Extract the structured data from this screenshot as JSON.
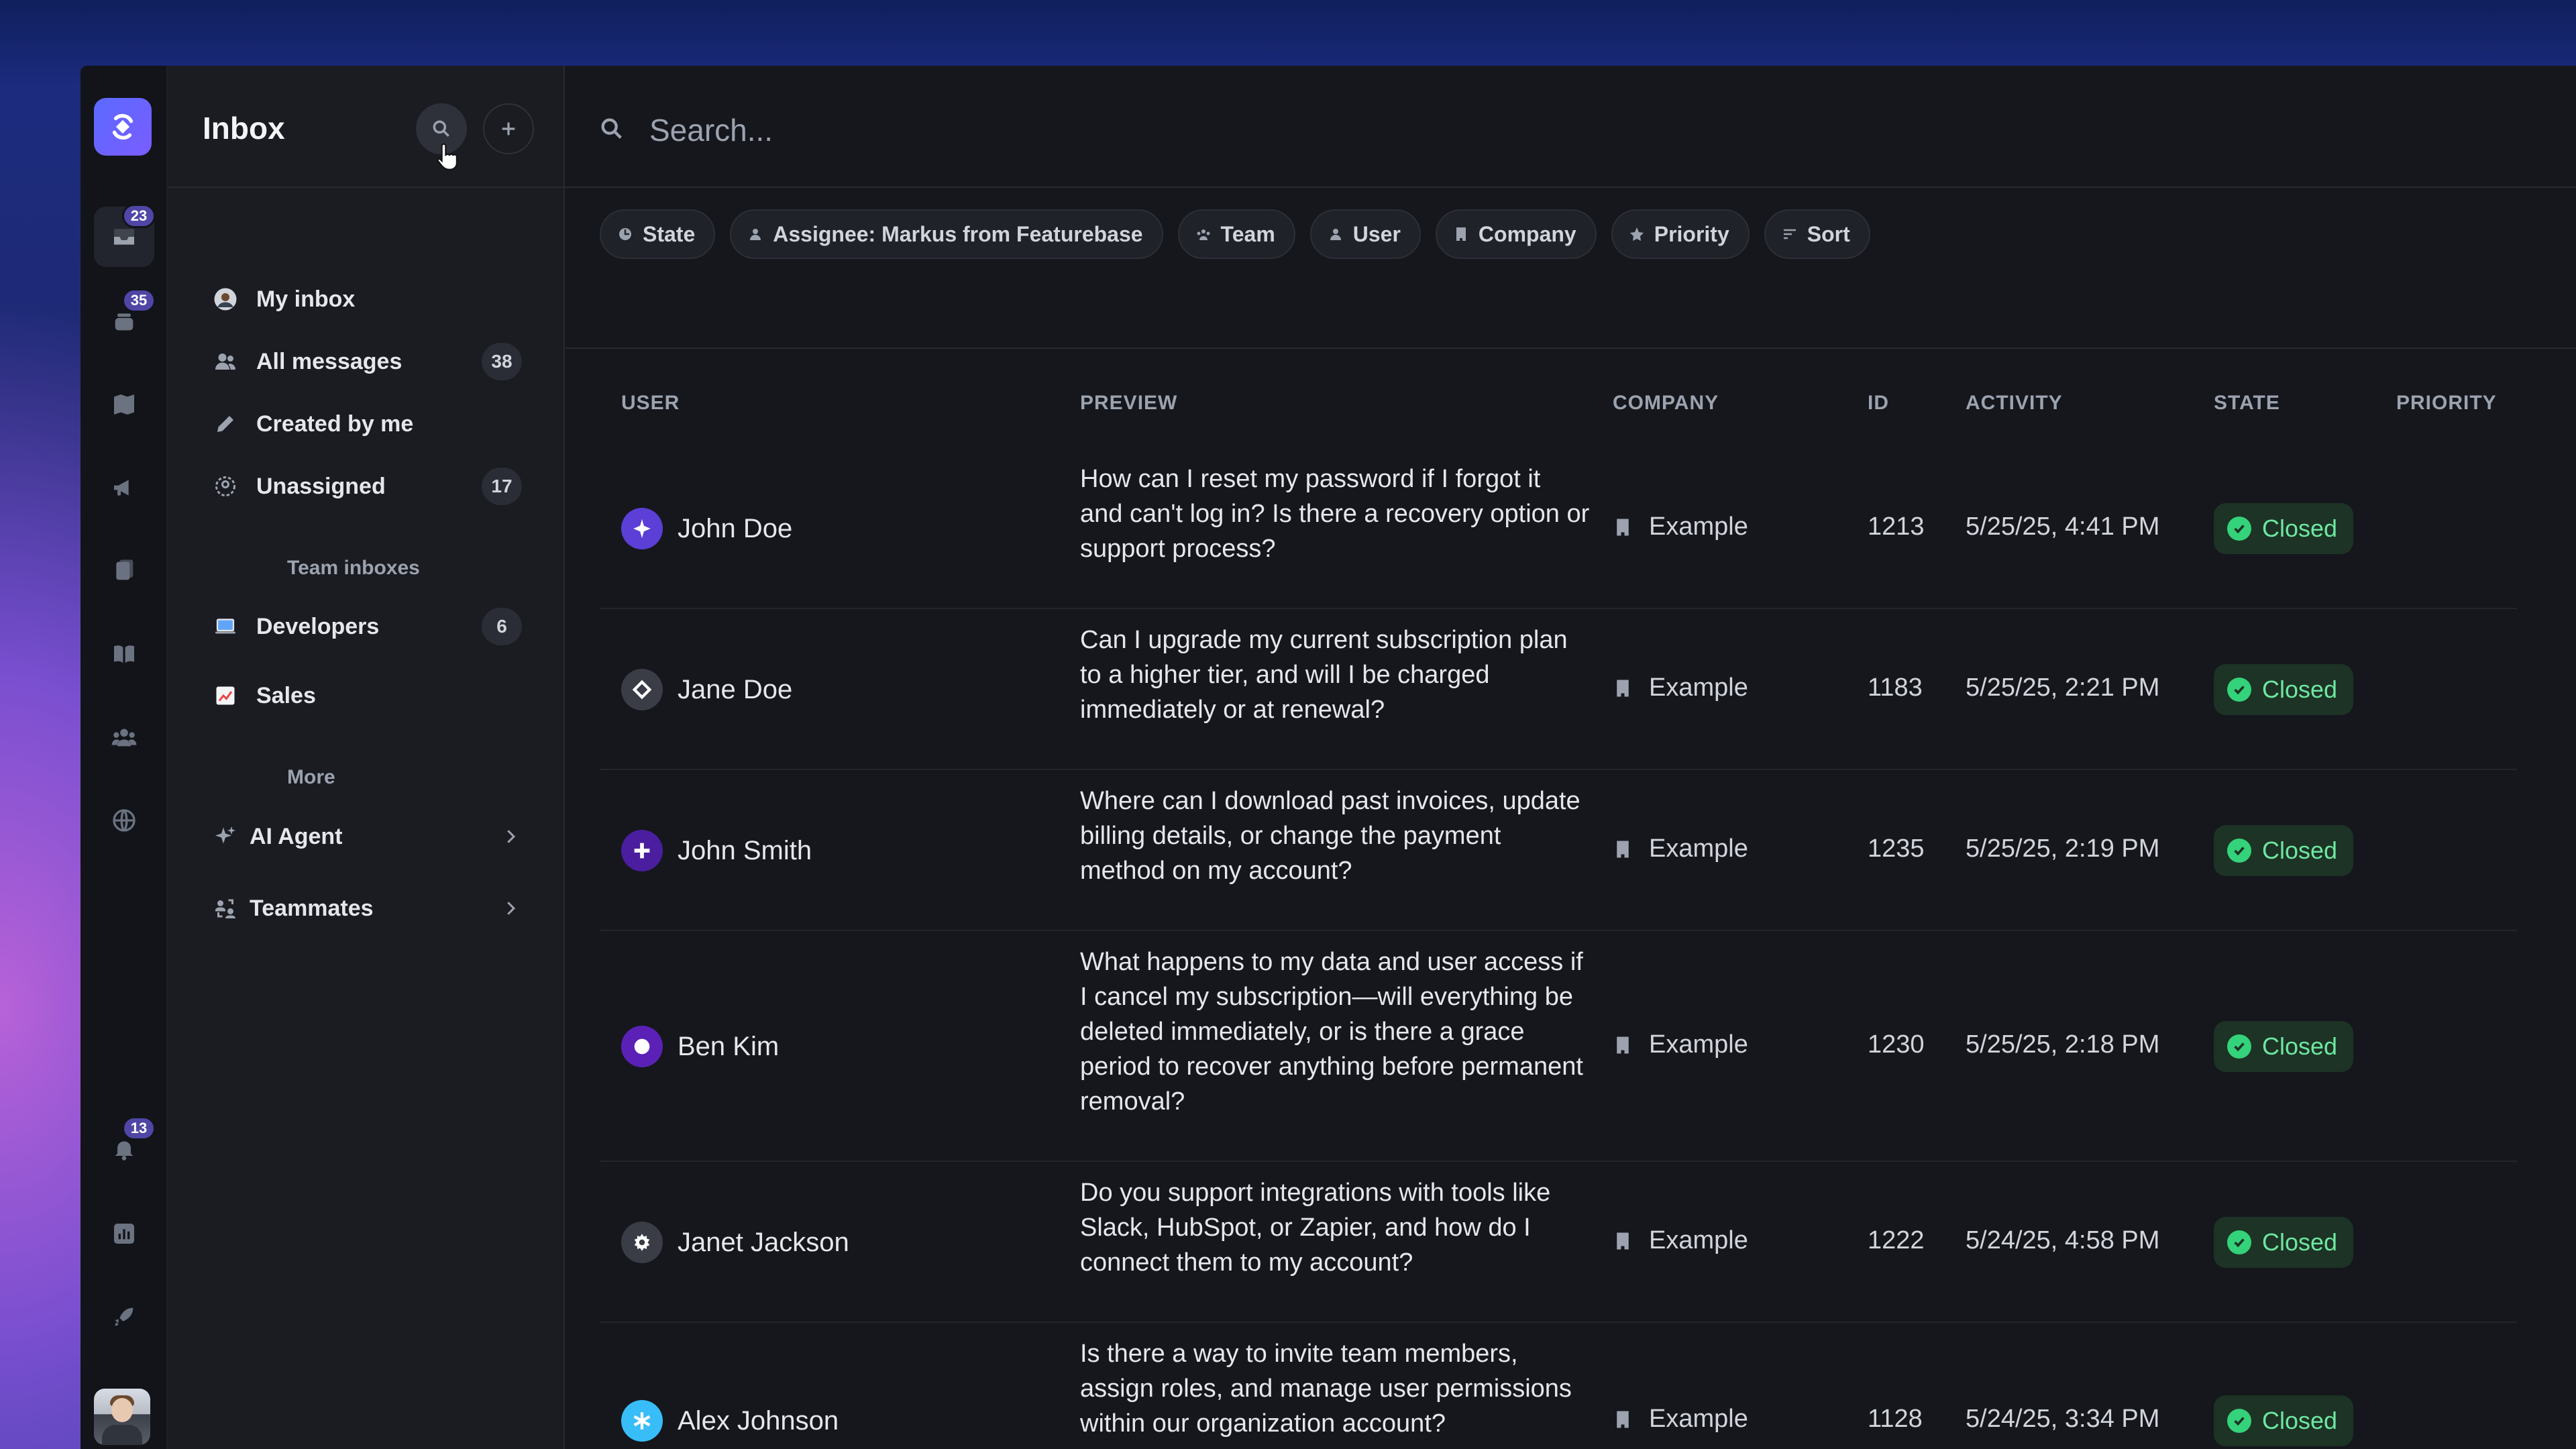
{
  "colors": {
    "accent": "#5b6bff",
    "badge": "#4f46a5",
    "closed_bg": "#1d3325",
    "closed_text": "#6ee7a1"
  },
  "rail": {
    "badges": {
      "inbox": "23",
      "messages": "35",
      "notifications": "13"
    }
  },
  "sidebar": {
    "title": "Inbox",
    "items": [
      {
        "label": "My inbox",
        "count": ""
      },
      {
        "label": "All messages",
        "count": "38"
      },
      {
        "label": "Created by me",
        "count": ""
      },
      {
        "label": "Unassigned",
        "count": "17"
      }
    ],
    "team_label": "Team inboxes",
    "teams": [
      {
        "label": "Developers",
        "count": "6"
      },
      {
        "label": "Sales",
        "count": ""
      }
    ],
    "more_label": "More",
    "more": [
      {
        "label": "AI Agent"
      },
      {
        "label": "Teammates"
      }
    ]
  },
  "search": {
    "placeholder": "Search..."
  },
  "filters": [
    "State",
    "Assignee: Markus from Featurebase",
    "Team",
    "User",
    "Company",
    "Priority",
    "Sort"
  ],
  "table": {
    "headers": {
      "user": "USER",
      "preview": "PREVIEW",
      "company": "COMPANY",
      "id": "ID",
      "activity": "ACTIVITY",
      "state": "STATE",
      "priority": "PRIORITY"
    },
    "rows": [
      {
        "user": "John Doe",
        "avatar_color": "#5b3fd6",
        "avatar_icon": "sparkle-icon",
        "preview": "How can I reset my password if I forgot it and can't log in? Is there a recovery option or support process?",
        "company": "Example",
        "id": "1213",
        "activity": "5/25/25, 4:41 PM",
        "state": "Closed"
      },
      {
        "user": "Jane Doe",
        "avatar_color": "#3a3d46",
        "avatar_icon": "diamond-icon",
        "preview": "Can I upgrade my current subscription plan to a higher tier, and will I be charged immediately or at renewal?",
        "company": "Example",
        "id": "1183",
        "activity": "5/25/25, 2:21 PM",
        "state": "Closed"
      },
      {
        "user": "John Smith",
        "avatar_color": "#4a1e9e",
        "avatar_icon": "plus-icon",
        "preview": "Where can I download past invoices, update billing details, or change the payment method on my account?",
        "company": "Example",
        "id": "1235",
        "activity": "5/25/25, 2:19 PM",
        "state": "Closed"
      },
      {
        "user": "Ben Kim",
        "avatar_color": "#5b21b6",
        "avatar_icon": "circle-icon",
        "preview": "What happens to my data and user access if I cancel my subscription—will everything be deleted immediately, or is there a grace period to recover anything before permanent removal?",
        "company": "Example",
        "id": "1230",
        "activity": "5/25/25, 2:18 PM",
        "state": "Closed"
      },
      {
        "user": "Janet Jackson",
        "avatar_color": "#3a3d46",
        "avatar_icon": "gear-icon",
        "preview": "Do you support integrations with tools like Slack, HubSpot, or Zapier, and how do I connect them to my account?",
        "company": "Example",
        "id": "1222",
        "activity": "5/24/25, 4:58 PM",
        "state": "Closed"
      },
      {
        "user": "Alex Johnson",
        "avatar_color": "#38bdf8",
        "avatar_icon": "asterisk-icon",
        "preview": "Is there a way to invite team members, assign roles, and manage user permissions within our organization account?",
        "company": "Example",
        "id": "1128",
        "activity": "5/24/25, 3:34 PM",
        "state": "Closed"
      }
    ]
  }
}
